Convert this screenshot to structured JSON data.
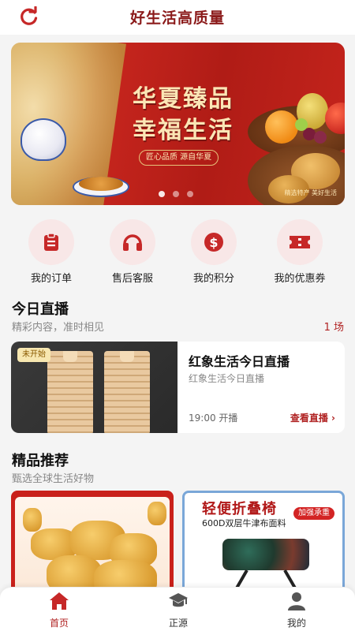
{
  "header": {
    "title": "好生活高质量",
    "refresh_icon": "refresh-icon"
  },
  "banner": {
    "slogan_line1": "华夏臻品",
    "slogan_line2": "幸福生活",
    "tagline": "匠心品质 源自华夏",
    "caption": "精选特产 美好生活",
    "slide_count": 3,
    "active_slide": 1
  },
  "quick_actions": [
    {
      "label": "我的订单",
      "icon": "clipboard-icon"
    },
    {
      "label": "售后客服",
      "icon": "headphones-icon"
    },
    {
      "label": "我的积分",
      "icon": "dollar-coin-icon"
    },
    {
      "label": "我的优惠券",
      "icon": "ticket-icon"
    }
  ],
  "live_section": {
    "title": "今日直播",
    "subtitle": "精彩内容，准时相见",
    "count": "1 场",
    "card": {
      "badge": "未开始",
      "title": "红象生活今日直播",
      "description": "红象生活今日直播",
      "time": "19:00 开播",
      "link": "查看直播 ›"
    }
  },
  "recommend_section": {
    "title": "精品推荐",
    "subtitle": "甄选全球生活好物",
    "products": [
      {
        "image": "snack-product-image"
      },
      {
        "title": "轻便折叠椅",
        "tag": "加强承重",
        "subtitle": "600D双层牛津布面料"
      }
    ]
  },
  "tabbar": [
    {
      "label": "首页",
      "icon": "home-icon",
      "active": true
    },
    {
      "label": "正源",
      "icon": "graduation-cap-icon",
      "active": false
    },
    {
      "label": "我的",
      "icon": "user-icon",
      "active": false
    }
  ],
  "colors": {
    "brand": "#b02222",
    "title": "#8b1a1a",
    "background": "#f4f4f4"
  }
}
